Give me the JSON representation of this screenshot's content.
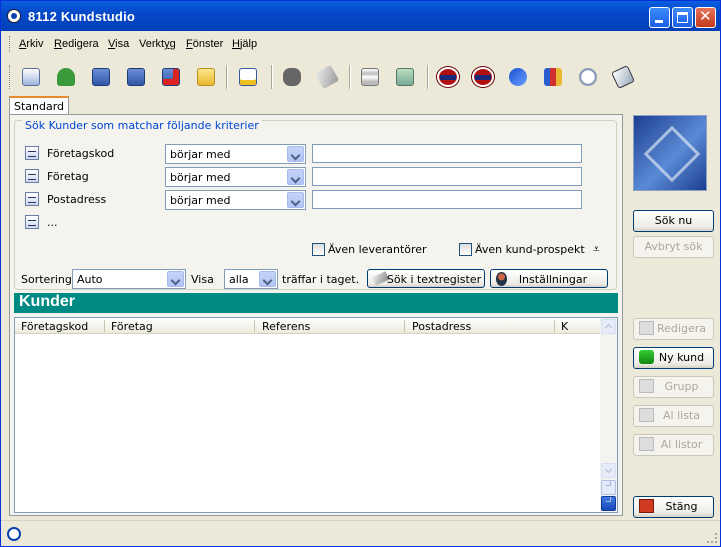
{
  "window": {
    "title": "8112 Kundstudio"
  },
  "menu": [
    {
      "pre": "",
      "acc": "A",
      "post": "rkiv"
    },
    {
      "pre": "",
      "acc": "R",
      "post": "edigera"
    },
    {
      "pre": "",
      "acc": "V",
      "post": "isa"
    },
    {
      "pre": "Verkt",
      "acc": "y",
      "post": "g"
    },
    {
      "pre": "",
      "acc": "F",
      "post": "önster"
    },
    {
      "pre": "",
      "acc": "H",
      "post": "jälp"
    }
  ],
  "toolbar_icons": [
    "copy-record-icon",
    "add-user-icon",
    "new-table-icon",
    "save-table-icon",
    "delete-table-icon",
    "open-folder-icon",
    "checklist-icon",
    "binoculars-icon",
    "eraser-icon",
    "database-icon",
    "export-icon",
    "kund-icon",
    "lev-icon",
    "transfer-icon",
    "books-icon",
    "stopwatch-icon",
    "notebook-icon"
  ],
  "tab": {
    "label": "Standard"
  },
  "search": {
    "legend": "Sök  Kunder som matchar följande kriterier",
    "rows": [
      {
        "label": "Företagskod",
        "operator": "börjar med",
        "value": ""
      },
      {
        "label": "Företag",
        "operator": "börjar med",
        "value": ""
      },
      {
        "label": "Postadress",
        "operator": "börjar med",
        "value": ""
      }
    ],
    "more_label": "...",
    "also_suppliers": "Även leverantörer",
    "also_prospects": "Även kund-prospekt",
    "sort_label": "Sortering",
    "sort_value": "Auto",
    "show_label": "Visa",
    "show_value": "alla",
    "hits_label": "träffar i taget.",
    "text_search_button": "Sök i textregister",
    "settings_button": "Inställningar"
  },
  "list": {
    "title": "Kunder",
    "columns": [
      "Företagskod",
      "Företag",
      "Referens",
      "Postadress",
      "K"
    ]
  },
  "side_buttons": {
    "search_now": "Sök nu",
    "cancel_search": "Avbryt sök",
    "edit": "Redigera",
    "new_customer": "Ny kund",
    "group": "Grupp",
    "to_list": "Al lista",
    "to_lists": "Al listor",
    "close": "Stäng"
  }
}
